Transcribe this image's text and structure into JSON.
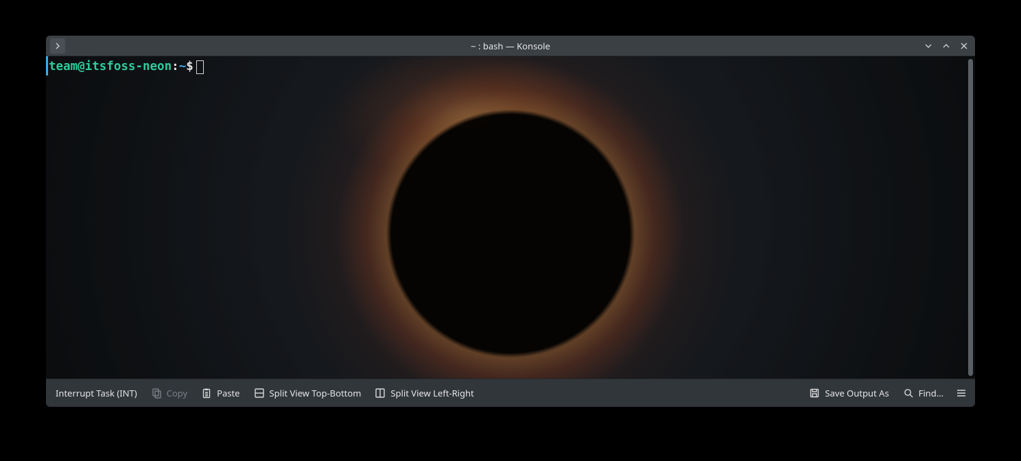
{
  "window": {
    "title": "~ : bash — Konsole"
  },
  "prompt": {
    "user": "team",
    "at": "@",
    "host": "itsfoss-neon",
    "colon": ":",
    "path": "~",
    "symbol": "$"
  },
  "toolbar": {
    "interrupt": "Interrupt Task (INT)",
    "copy": "Copy",
    "paste": "Paste",
    "split_tb": "Split View Top-Bottom",
    "split_lr": "Split View Left-Right",
    "save_output": "Save Output As",
    "find": "Find…"
  }
}
